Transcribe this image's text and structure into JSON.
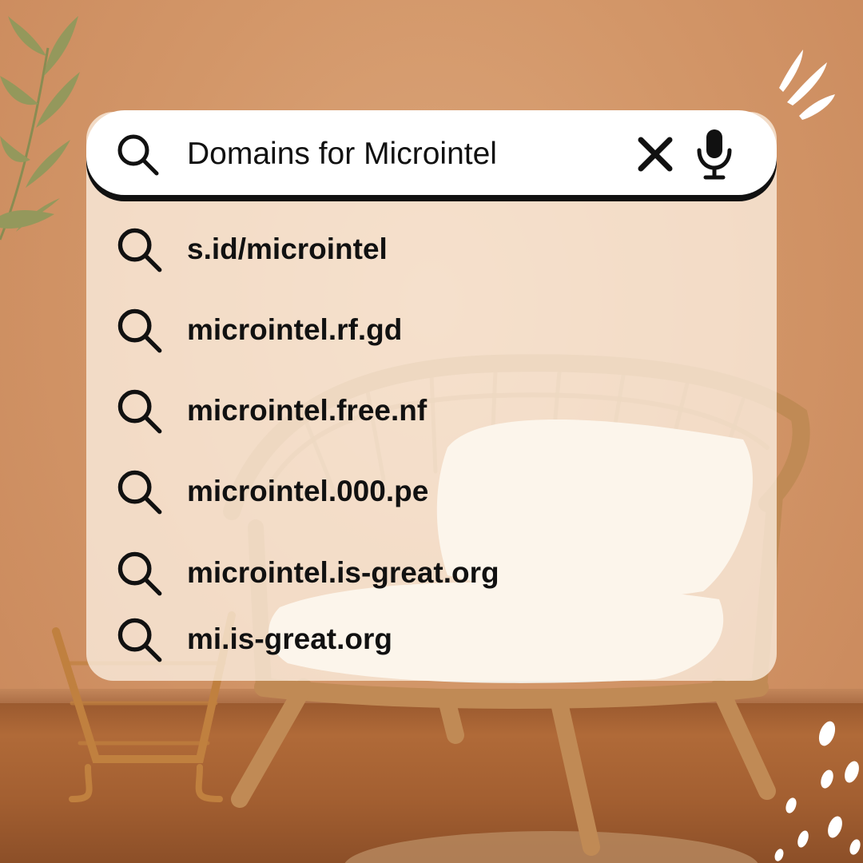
{
  "search": {
    "query": "Domains for Microintel",
    "search_icon": "search-icon",
    "clear_icon": "close-icon",
    "voice_icon": "microphone-icon"
  },
  "suggestions": [
    {
      "label": "s.id/microintel",
      "icon": "search-icon"
    },
    {
      "label": "microintel.rf.gd",
      "icon": "search-icon"
    },
    {
      "label": "microintel.free.nf",
      "icon": "search-icon"
    },
    {
      "label": "microintel.000.pe",
      "icon": "search-icon"
    },
    {
      "label": "microintel.is-great.org",
      "icon": "search-icon"
    },
    {
      "label": "mi.is-great.org",
      "icon": "search-icon"
    }
  ],
  "colors": {
    "wall": "#d39769",
    "panel": "#fff6ec",
    "text": "#111111",
    "leaf": "#8a9a5b"
  }
}
